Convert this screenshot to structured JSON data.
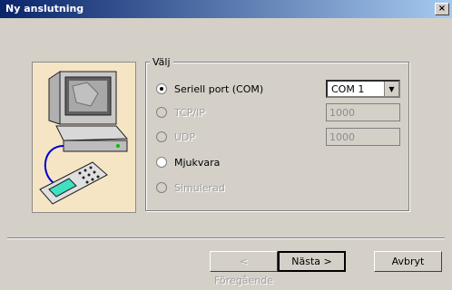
{
  "window": {
    "title": "Ny anslutning",
    "close_label": "×"
  },
  "group": {
    "label": "Välj"
  },
  "options": [
    {
      "label": "Seriell port (COM)",
      "checked": true,
      "disabled": false
    },
    {
      "label": "TCP/IP",
      "checked": false,
      "disabled": true
    },
    {
      "label": "UDP",
      "checked": false,
      "disabled": true
    },
    {
      "label": "Mjukvara",
      "checked": false,
      "disabled": false
    },
    {
      "label": "Simulerad",
      "checked": false,
      "disabled": true
    }
  ],
  "com_select": {
    "value": "COM 1"
  },
  "tcp_port": {
    "value": "1000"
  },
  "udp_port": {
    "value": "1000"
  },
  "buttons": {
    "back": "< Föregående",
    "next": "Nästa >",
    "cancel": "Avbryt"
  }
}
